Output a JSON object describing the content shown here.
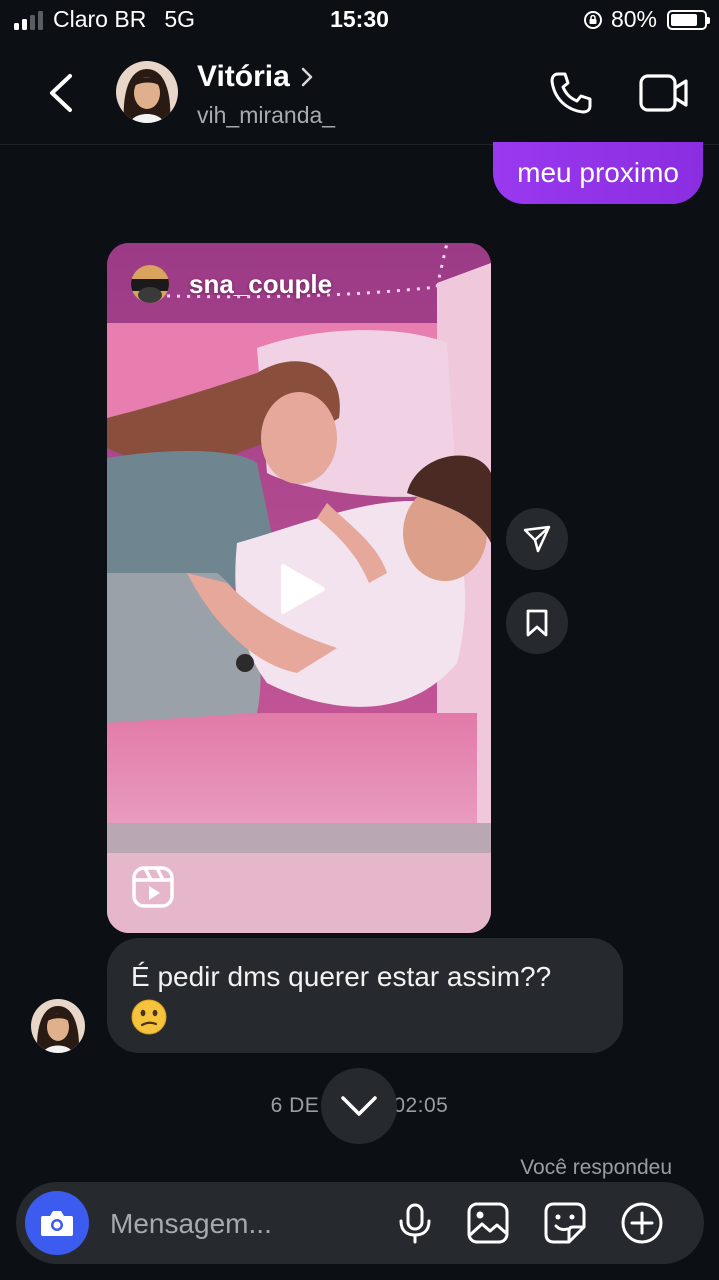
{
  "status_bar": {
    "carrier": "Claro BR",
    "network": "5G",
    "time": "15:30",
    "battery": "80%",
    "battery_level": 0.8
  },
  "header": {
    "name": "Vitória",
    "username": "vih_miranda_"
  },
  "messages": {
    "sent_text": "meu proximo",
    "reel_owner": "sna_couple",
    "received_text": "É pedir dms querer estar assim??",
    "received_emoji": "confused-face"
  },
  "timestamp": "6 DE ... 02:05",
  "timestamp_left": "6 DE",
  "timestamp_right": "02:05",
  "reply_note": "Você respondeu",
  "composer": {
    "placeholder": "Mensagem..."
  },
  "colors": {
    "background": "#0c1014",
    "sent_bubble": "#8b2de0",
    "received_bubble": "#262a2f",
    "camera_button": "#3c5cf0"
  }
}
